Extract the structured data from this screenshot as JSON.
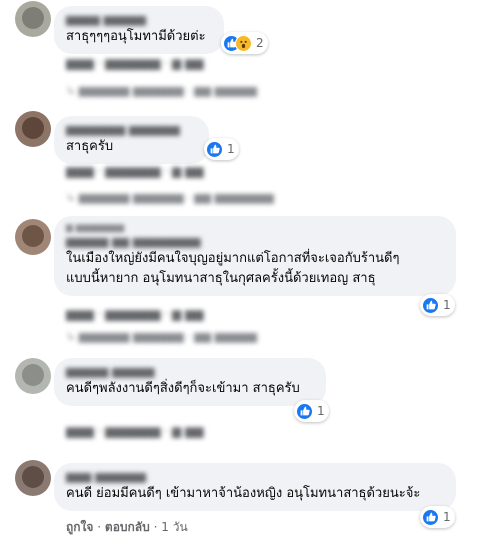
{
  "comments": [
    {
      "text_lines": [
        "สาธุๆๆๆอนุโมทามีด้วยต่ะ"
      ],
      "reaction_count": "2",
      "reaction_icons": [
        "like-icon",
        "wow-icon"
      ]
    },
    {
      "text_lines": [
        "สาธุครับ"
      ],
      "reaction_count": "1",
      "reaction_icons": [
        "like-icon"
      ]
    },
    {
      "text_lines": [
        "ในเมืองใหญ่ยังมีคนใจบุญอยู่มากแต่โอกาสที่จะเจอกับร้านดีๆ",
        "แบบนี้หายาก อนุโมทนาสาธุในกุศลครั้งนี้ด้วยเทอญ สาธุ"
      ],
      "reaction_count": "1",
      "reaction_icons": [
        "like-icon"
      ]
    },
    {
      "text_lines": [
        "คนดีๆพลังงานดีๆสิ่งดีๆก็จะเข้ามา สาธุครับ"
      ],
      "reaction_count": "1",
      "reaction_icons": [
        "like-icon"
      ]
    },
    {
      "text_lines": [
        "คนดี ย่อมมีคนดีๆ เข้ามาหาจ้าน้องหญิง อนุโมทนาสาธุด้วยนะจ้ะ"
      ],
      "reaction_count": "1",
      "reaction_icons": [
        "like-icon"
      ],
      "actions": {
        "like": "ถูกใจ",
        "reply": "ตอบกลับ",
        "age": "1 วัน",
        "sep": "·"
      }
    }
  ],
  "colors": {
    "bubble": "#f0f2f5",
    "like": "#1877f2",
    "wow": "#f7b928",
    "secondary_text": "#65676b"
  }
}
